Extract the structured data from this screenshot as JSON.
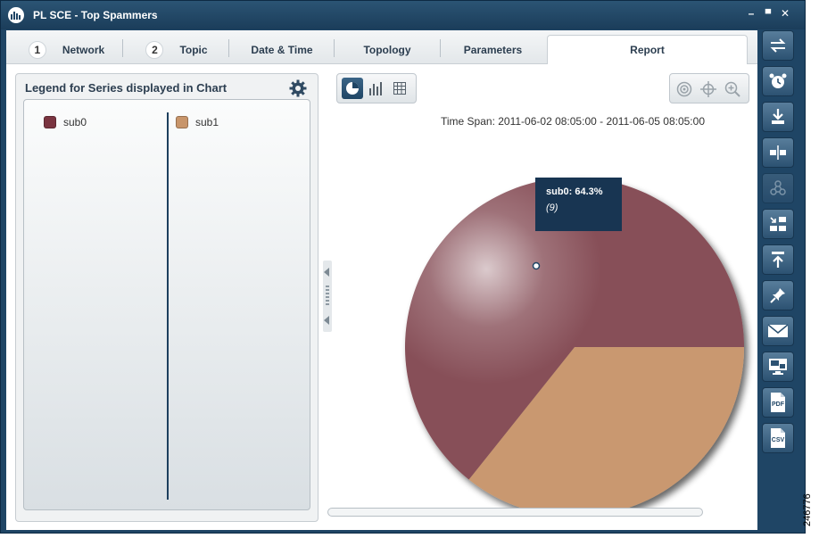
{
  "window": {
    "title": "PL SCE - Top Spammers",
    "controls": [
      "–",
      "▀",
      "✕"
    ]
  },
  "tabs": [
    {
      "num": "1",
      "label": "Network"
    },
    {
      "num": "2",
      "label": "Topic"
    },
    {
      "num": "",
      "label": "Date & Time"
    },
    {
      "num": "",
      "label": "Topology"
    },
    {
      "num": "",
      "label": "Parameters"
    },
    {
      "num": "",
      "label": "Report",
      "active": true
    }
  ],
  "legend": {
    "title": "Legend for Series displayed in Chart",
    "items": [
      {
        "label": "sub0",
        "color": "#7a3440"
      },
      {
        "label": "sub1",
        "color": "#c8956a"
      }
    ]
  },
  "chart": {
    "time_span": "Time Span: 2011-06-02 08:05:00 - 2011-06-05 08:05:00"
  },
  "chart_data": {
    "type": "pie",
    "series": [
      {
        "name": "sub0",
        "value": 9,
        "percent": 64.3,
        "color": "#875059"
      },
      {
        "name": "sub1",
        "value": 5,
        "percent": 35.7,
        "color": "#c9986f"
      }
    ]
  },
  "tooltip": {
    "label": "sub0:  64.3%",
    "count": "(9)"
  },
  "toolbar": {
    "icons": [
      "swap-arrows-icon",
      "alarm-clock-icon",
      "download-icon",
      "split-icon",
      "network-nodes-icon",
      "arrange-icon",
      "upload-icon",
      "pin-icon",
      "mail-icon",
      "monitor-icon",
      "pdf-icon",
      "csv-icon"
    ],
    "pdf_label": "PDF",
    "csv_label": "CSV"
  },
  "figure_id": "246776"
}
